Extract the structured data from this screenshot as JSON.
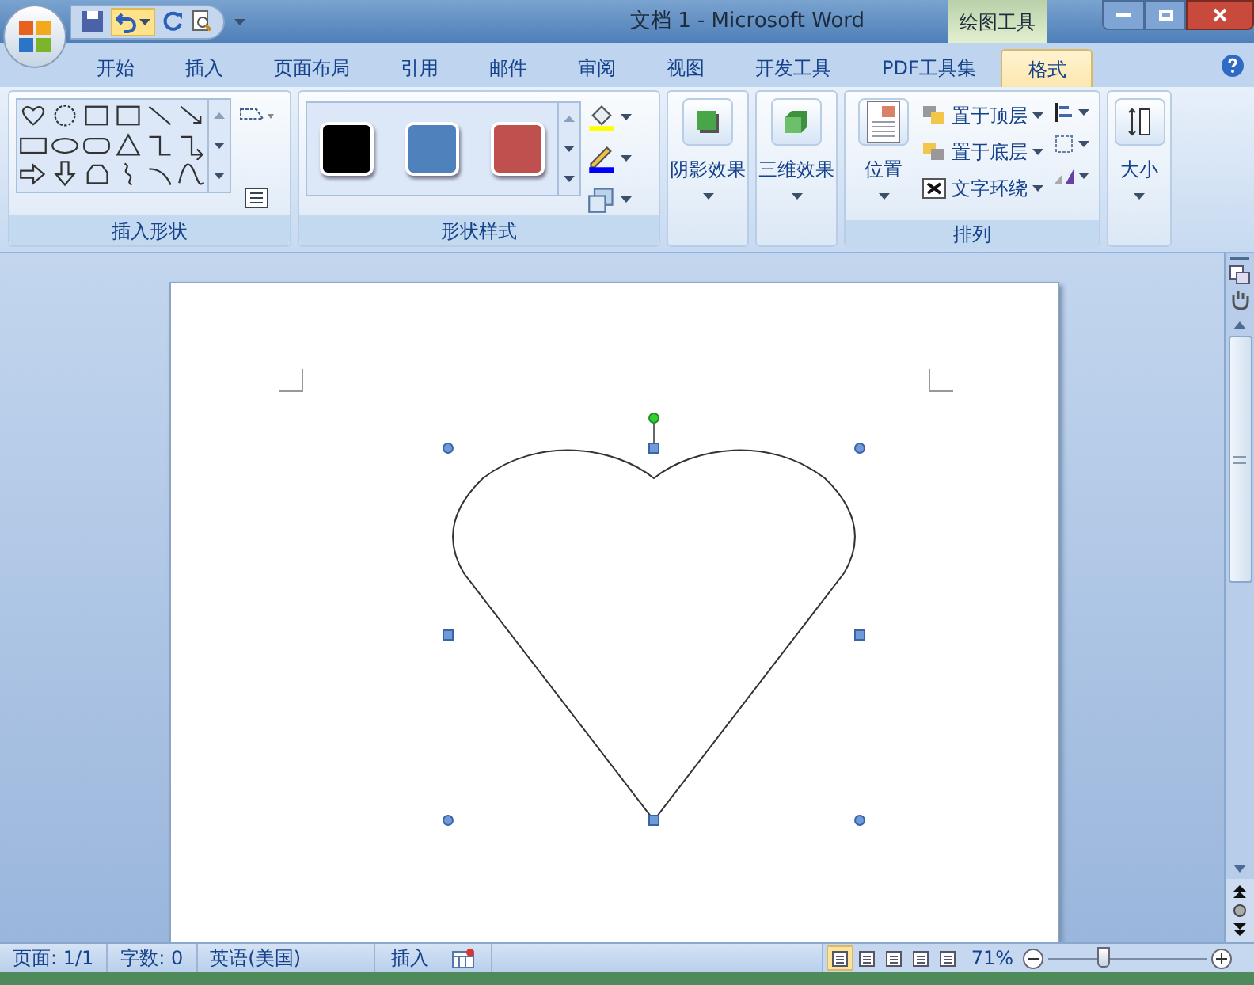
{
  "window": {
    "title": "文档 1 - Microsoft Word",
    "context_group": "绘图工具"
  },
  "tabs": [
    {
      "label": "开始",
      "selected": false
    },
    {
      "label": "插入",
      "selected": false
    },
    {
      "label": "页面布局",
      "selected": false
    },
    {
      "label": "引用",
      "selected": false
    },
    {
      "label": "邮件",
      "selected": false
    },
    {
      "label": "审阅",
      "selected": false
    },
    {
      "label": "视图",
      "selected": false
    },
    {
      "label": "开发工具",
      "selected": false
    },
    {
      "label": "PDF工具集",
      "selected": false
    },
    {
      "label": "格式",
      "selected": true
    }
  ],
  "ribbon": {
    "insert_shapes": {
      "label": "插入形状"
    },
    "shape_styles": {
      "label": "形状样式",
      "swatches": [
        {
          "color": "#000000"
        },
        {
          "color": "#4f81bd"
        },
        {
          "color": "#c0504d"
        }
      ]
    },
    "shadow_effects": {
      "label": "阴影效果"
    },
    "threed_effects": {
      "label": "三维效果"
    },
    "arrange": {
      "label": "排列",
      "position": "位置",
      "commands": [
        "置于顶层",
        "置于底层",
        "文字环绕"
      ]
    },
    "size": {
      "label": "大小"
    }
  },
  "status_bar": {
    "items": [
      "页面: 1/1",
      "字数: 0",
      "英语(美国)",
      "插入"
    ],
    "views": [
      {
        "selected": true
      },
      {
        "selected": false
      },
      {
        "selected": false
      },
      {
        "selected": false
      },
      {
        "selected": false
      }
    ],
    "zoom": "71%",
    "zoom_slider": {
      "level": 0.35
    }
  }
}
